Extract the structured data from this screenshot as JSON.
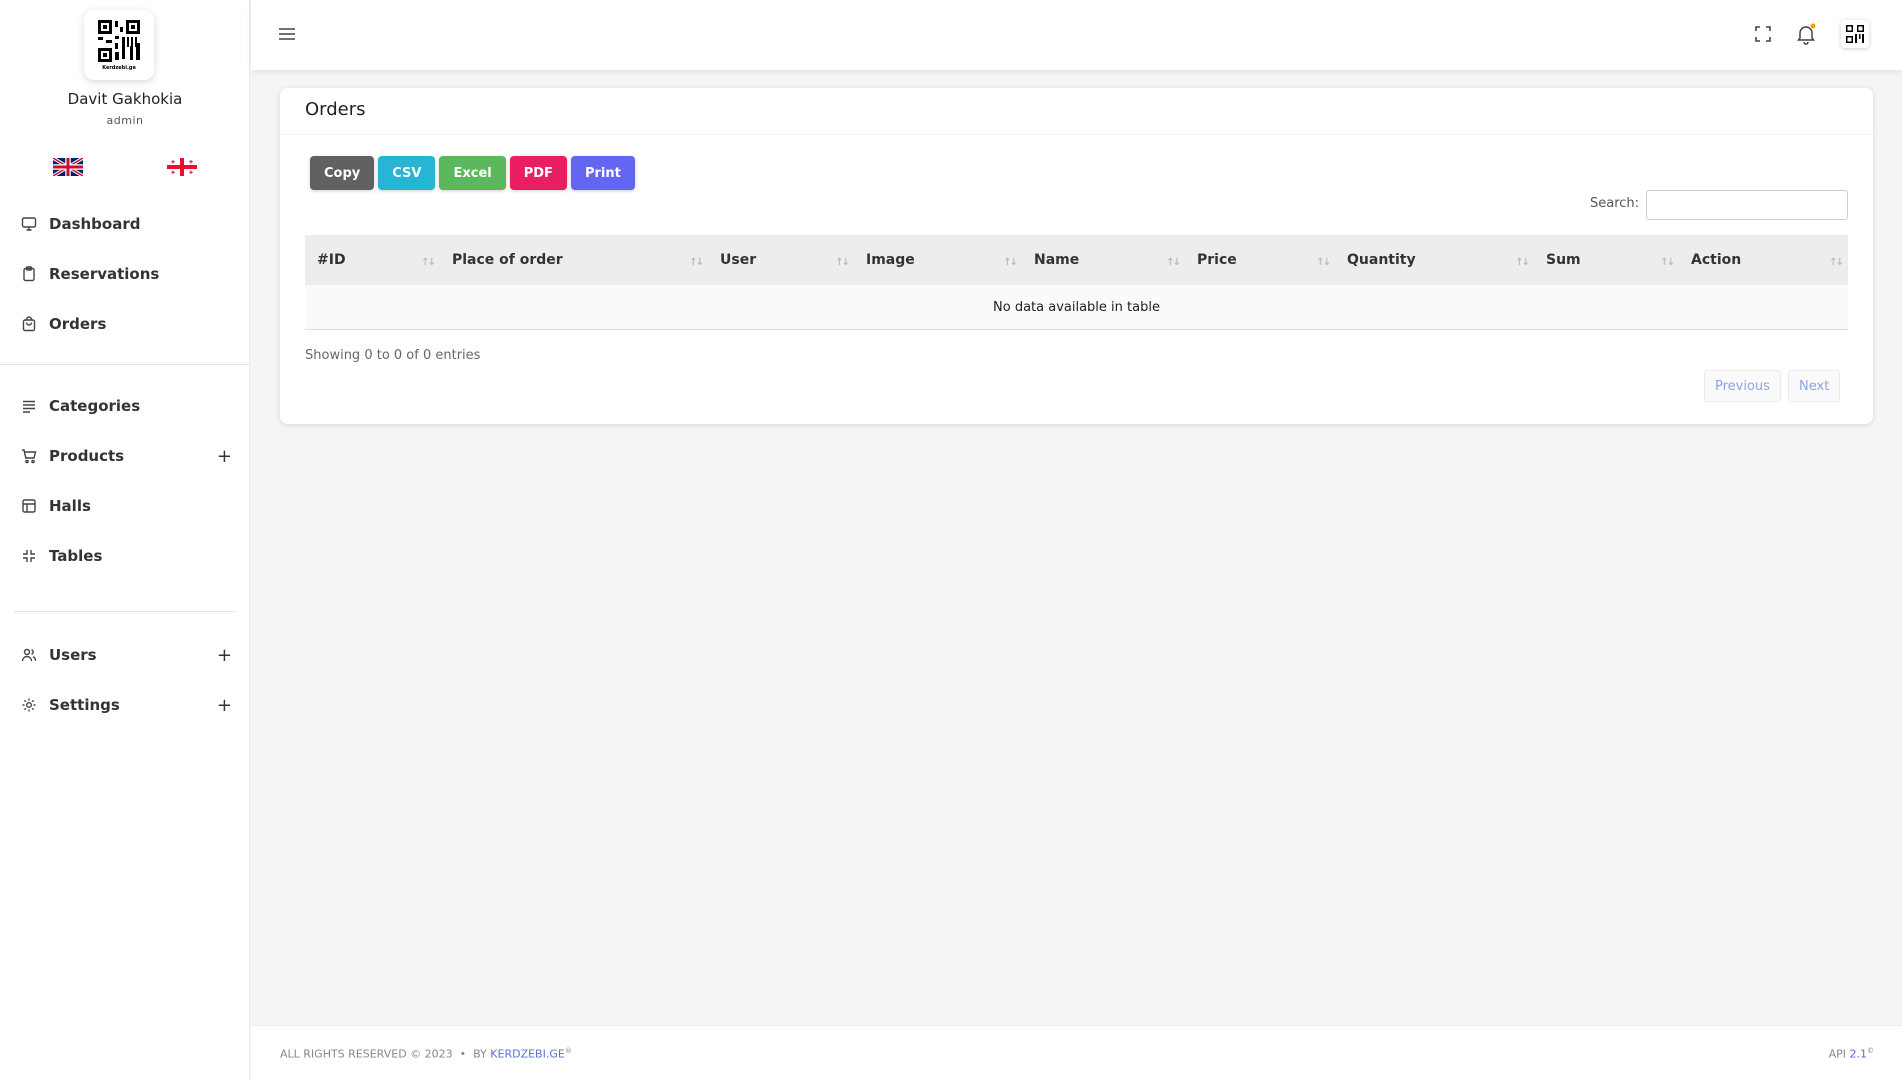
{
  "sidebar": {
    "user_name": "Davit Gakhokia",
    "user_role": "admin",
    "logo_text": "Kerdzebi.ge",
    "nav_items": [
      {
        "label": "Dashboard",
        "icon": "monitor-icon"
      },
      {
        "label": "Reservations",
        "icon": "clipboard-icon"
      },
      {
        "label": "Orders",
        "icon": "shopping-bag-icon"
      },
      {
        "label": "Categories",
        "icon": "list-icon"
      },
      {
        "label": "Products",
        "icon": "cart-icon",
        "expand": "+"
      },
      {
        "label": "Halls",
        "icon": "layout-icon"
      },
      {
        "label": "Tables",
        "icon": "shrink-icon"
      },
      {
        "label": "Users",
        "icon": "users-icon",
        "expand": "+"
      },
      {
        "label": "Settings",
        "icon": "gear-icon",
        "expand": "+"
      }
    ]
  },
  "page": {
    "title": "Orders",
    "export_buttons": [
      {
        "label": "Copy",
        "color": "#616161"
      },
      {
        "label": "CSV",
        "color": "#26b6d4"
      },
      {
        "label": "Excel",
        "color": "#5cb85c"
      },
      {
        "label": "PDF",
        "color": "#e91e63"
      },
      {
        "label": "Print",
        "color": "#6366f1"
      }
    ],
    "search_label": "Search:",
    "search_value": "",
    "table": {
      "columns": [
        "#ID",
        "Place of order",
        "User",
        "Image",
        "Name",
        "Price",
        "Quantity",
        "Sum",
        "Action"
      ],
      "empty_message": "No data available in table"
    },
    "info": "Showing 0 to 0 of 0 entries",
    "pager": {
      "previous": "Previous",
      "next": "Next"
    }
  },
  "footer": {
    "left_text": "ALL RIGHTS RESERVED © 2023  •  BY ",
    "brand": "KERDZEBI.GE",
    "brand_sup": "®",
    "right_label": "API ",
    "version": "2.1",
    "version_sup": "©"
  },
  "colors": {
    "accent": "#5a6fd6",
    "notification_dot": "#f59e0b"
  }
}
